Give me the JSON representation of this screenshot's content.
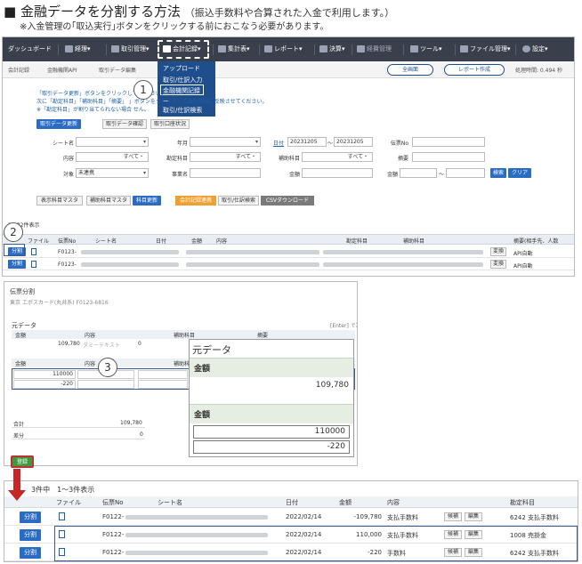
{
  "heading": {
    "title": "■ 金融データを分割する方法",
    "subtitle": "（振込手数料や合算された入金で利用します。）",
    "note": "※入金管理の｢取込実行｣ボタンをクリックする前におこなう必要があります。"
  },
  "steps": [
    "1",
    "2",
    "3"
  ],
  "navbar": {
    "items": [
      {
        "label": "ダッシュボード",
        "icon": ""
      },
      {
        "label": "経理▾",
        "icon": "ledger-icon"
      },
      {
        "label": "取引管理▾",
        "icon": "refresh-icon"
      },
      {
        "label": "会計記録▾",
        "icon": "check-icon"
      },
      {
        "label": "集計表▾",
        "icon": "table-icon"
      },
      {
        "label": "レポート▾",
        "icon": "monitor-icon"
      },
      {
        "label": "決算▾",
        "icon": "chart-icon"
      },
      {
        "label": "経費管理",
        "icon": "chart-icon"
      },
      {
        "label": "ツール▾",
        "icon": "wrench-icon"
      },
      {
        "label": "ファイル管理▾",
        "icon": "file-icon"
      },
      {
        "label": "設定▾",
        "icon": "globe-icon"
      }
    ],
    "dropdown": [
      "アップロード",
      "取引/仕訳入力",
      "金融機関記録",
      "ー",
      "取引/仕訳検索"
    ]
  },
  "breadcrumbs": {
    "items": [
      "会計記録",
      "金融機関API",
      "取引データ編集"
    ],
    "full_screen": "全画面",
    "report": "レポート作成",
    "time": "処理時間: 0.494 秒"
  },
  "info_lines": [
    "「取引データ更新」ボタンをクリックして                               ください。",
    "次に「勘定科目」「補助科目」「摘要」                                 」ボタンをクリックして会計記録に反映させてください。",
    "※「勘定科目」が割り当てられない場合                               せん。"
  ],
  "action_buttons": {
    "update": "取引データ更新",
    "confirm": "取引データ確認",
    "account_status": "取引口座状況"
  },
  "filters": {
    "sheet_name": "シート名",
    "year_month": "年月",
    "date_link": "日付",
    "date_from": "20231205",
    "date_to": "20231205",
    "voucher_no": "伝票No",
    "content": "内容",
    "content_value": "すべて・",
    "account": "勘定科目",
    "account_value": "すべて・",
    "sub_account": "補助科目",
    "sub_account_value": "すべて・",
    "summary": "摘要",
    "target": "対象",
    "target_value": "未連携",
    "business": "事業名",
    "amount": "金額",
    "amount2": "金額",
    "tilde": "～",
    "search": "検索",
    "clear": "クリア"
  },
  "toolbar2": {
    "master": "表示科目マスタ",
    "sub_master": "補助科目マスタ",
    "update_subject": "科目更新",
    "link_record": "会計記録連携",
    "search_entry": "取引/仕訳検索",
    "csv": "CSVダウンロード"
  },
  "table1": {
    "summary": "1～32件表示",
    "headers": [
      "ファイル",
      "伝票No",
      "シート名",
      "日付",
      "金額",
      "内容",
      "勘定科目",
      "補助科目",
      "摘要(相手先、人数"
    ],
    "rows": [
      {
        "split": "分割",
        "voucher": "F0123-",
        "action": "変換",
        "summary": "API自動"
      },
      {
        "split": "分割",
        "voucher": "F0123-",
        "action": "変換",
        "summary": "API自動"
      }
    ]
  },
  "split_panel": {
    "title": "伝票分割",
    "subtitle": "東京 エポスカード(丸井系) F0123-6816",
    "original_label": "元データ",
    "hint": "[Enter] で次の",
    "headers_top": [
      "金額",
      "内容",
      "補助科目",
      "摘要"
    ],
    "row_top": {
      "amount": "109,780",
      "content": "ダミーテキスト",
      "count": "0"
    },
    "headers_mid": [
      "金額",
      "内容",
      "補助科目"
    ],
    "split_rows": [
      "110000",
      "-220"
    ],
    "total_label": "合計",
    "total_value": "109,780",
    "diff_label": "差分",
    "diff_value": "0",
    "register": "登録"
  },
  "zoom": {
    "title": "元データ",
    "amount_header": "金額",
    "original_amount": "109,780",
    "amount_header2": "金額",
    "input_value_1": "110000",
    "input_value_2": "-220"
  },
  "table3": {
    "summary": "3件中　1～3件表示",
    "headers": [
      "ファイル",
      "伝票No",
      "シート名",
      "日付",
      "金額",
      "内容",
      "勘定科目"
    ],
    "rows": [
      {
        "split": "分割",
        "voucher": "F0122-",
        "date": "2022/02/14",
        "amount": "-109,780",
        "content": "支払手数料",
        "btn1": "候補",
        "btn2": "編集",
        "account": "6242 支払手数料"
      },
      {
        "split": "分割",
        "voucher": "F0122-",
        "date": "2022/02/14",
        "amount": "110,000",
        "content": "支払手数料",
        "btn1": "候補",
        "btn2": "編集",
        "account": "1008 売掛金"
      },
      {
        "split": "分割",
        "voucher": "F0122-",
        "date": "2022/02/14",
        "amount": "-220",
        "content": "手数料",
        "btn1": "候補",
        "btn2": "編集",
        "account": "6242 支払手数料"
      }
    ]
  },
  "colors": {
    "navbar": "#3a3f4c",
    "accent": "#2a6cc4",
    "dropdown": "#1f4e8c",
    "register": "#3f9a3f",
    "arrow": "#c62828",
    "orange": "#f0a030"
  }
}
